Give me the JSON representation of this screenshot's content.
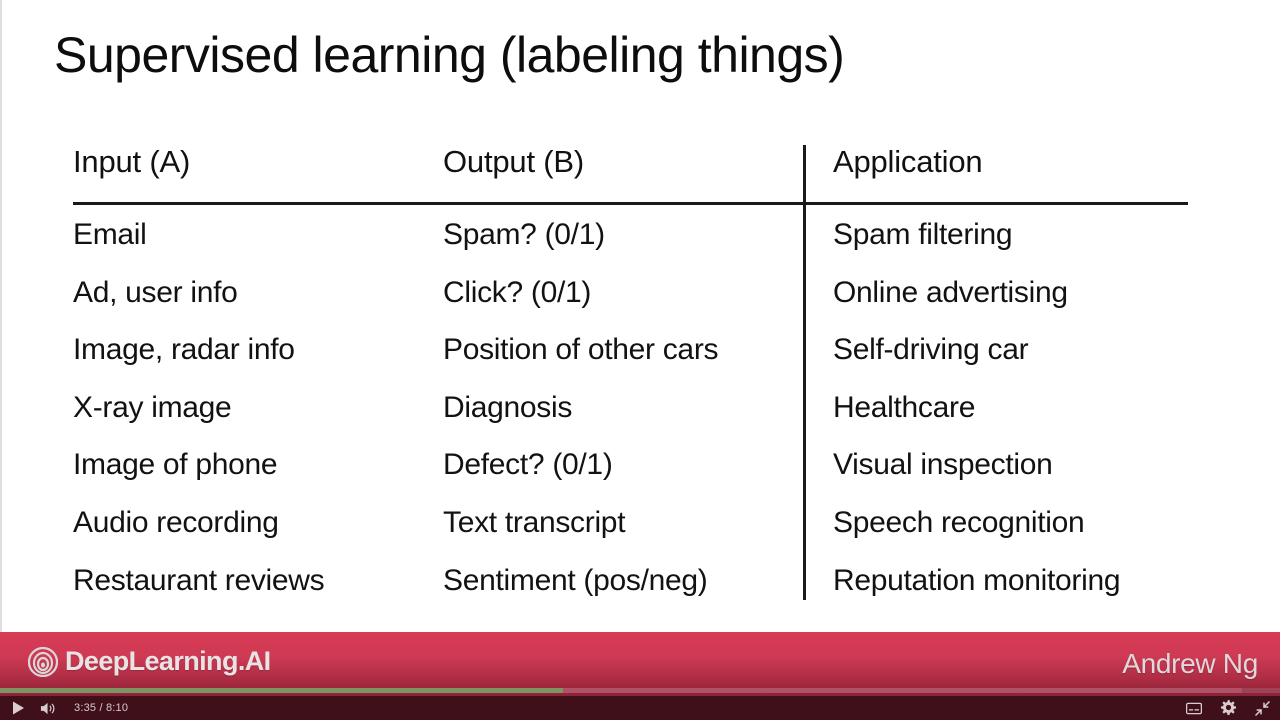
{
  "slide": {
    "title": "Supervised learning (labeling things)",
    "table": {
      "headers": [
        "Input (A)",
        "Output (B)",
        "Application"
      ],
      "rows": [
        {
          "input": "Email",
          "output": "Spam? (0/1)",
          "application": "Spam filtering"
        },
        {
          "input": "Ad, user info",
          "output": "Click? (0/1)",
          "application": "Online advertising"
        },
        {
          "input": "Image, radar info",
          "output": "Position of other cars",
          "application": "Self-driving car"
        },
        {
          "input": "X-ray image",
          "output": "Diagnosis",
          "application": "Healthcare"
        },
        {
          "input": "Image of phone",
          "output": "Defect? (0/1)",
          "application": "Visual inspection"
        },
        {
          "input": "Audio recording",
          "output": "Text transcript",
          "application": "Speech recognition"
        },
        {
          "input": "Restaurant reviews",
          "output": "Sentiment (pos/neg)",
          "application": "Reputation monitoring"
        }
      ]
    }
  },
  "branding": {
    "logo_icon": "deeplearning-ai-spiral-icon",
    "name": "DeepLearning.AI",
    "presenter": "Andrew Ng",
    "bar_color_top": "#d83b55",
    "bar_color_bottom": "#8a2236"
  },
  "controls": {
    "play_icon": "play-icon",
    "volume_icon": "volume-icon",
    "time_current": "3:35",
    "time_separator": "/",
    "time_total": "8:10",
    "time_display": "3:35  /  8:10",
    "captions_icon": "captions-icon",
    "settings_icon": "gear-icon",
    "fullscreen_icon": "exit-fullscreen-icon",
    "progress_percent": 44,
    "progress_fill_color": "#7e9463",
    "progress_track_color": "#9e4257"
  }
}
